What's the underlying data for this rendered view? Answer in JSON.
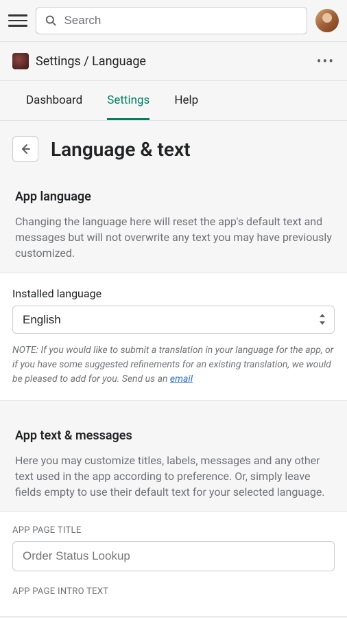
{
  "topbar": {
    "search_placeholder": "Search"
  },
  "breadcrumb": {
    "text": "Settings / Language"
  },
  "tabs": [
    {
      "label": "Dashboard",
      "active": false
    },
    {
      "label": "Settings",
      "active": true
    },
    {
      "label": "Help",
      "active": false
    }
  ],
  "page": {
    "title": "Language & text"
  },
  "sections": {
    "app_language": {
      "title": "App language",
      "description": "Changing the language here will reset the app's default text and messages but will not overwrite any text you may have previously customized."
    },
    "installed_language": {
      "label": "Installed language",
      "value": "English",
      "note_prefix": "NOTE: If you would like to submit a translation in your language for the app, or if you have some suggested refinements for an existing translation, we would be pleased to add for you. Send us an ",
      "note_link": "email"
    },
    "app_text": {
      "title": "App text & messages",
      "description": "Here you may customize titles, labels, messages and any other text used in the app according to preference. Or, simply leave fields empty to use their default text for your selected language."
    },
    "fields": {
      "app_page_title": {
        "label": "APP PAGE TITLE",
        "placeholder": "Order Status Lookup"
      },
      "app_page_intro": {
        "label": "APP PAGE INTRO TEXT"
      }
    }
  }
}
